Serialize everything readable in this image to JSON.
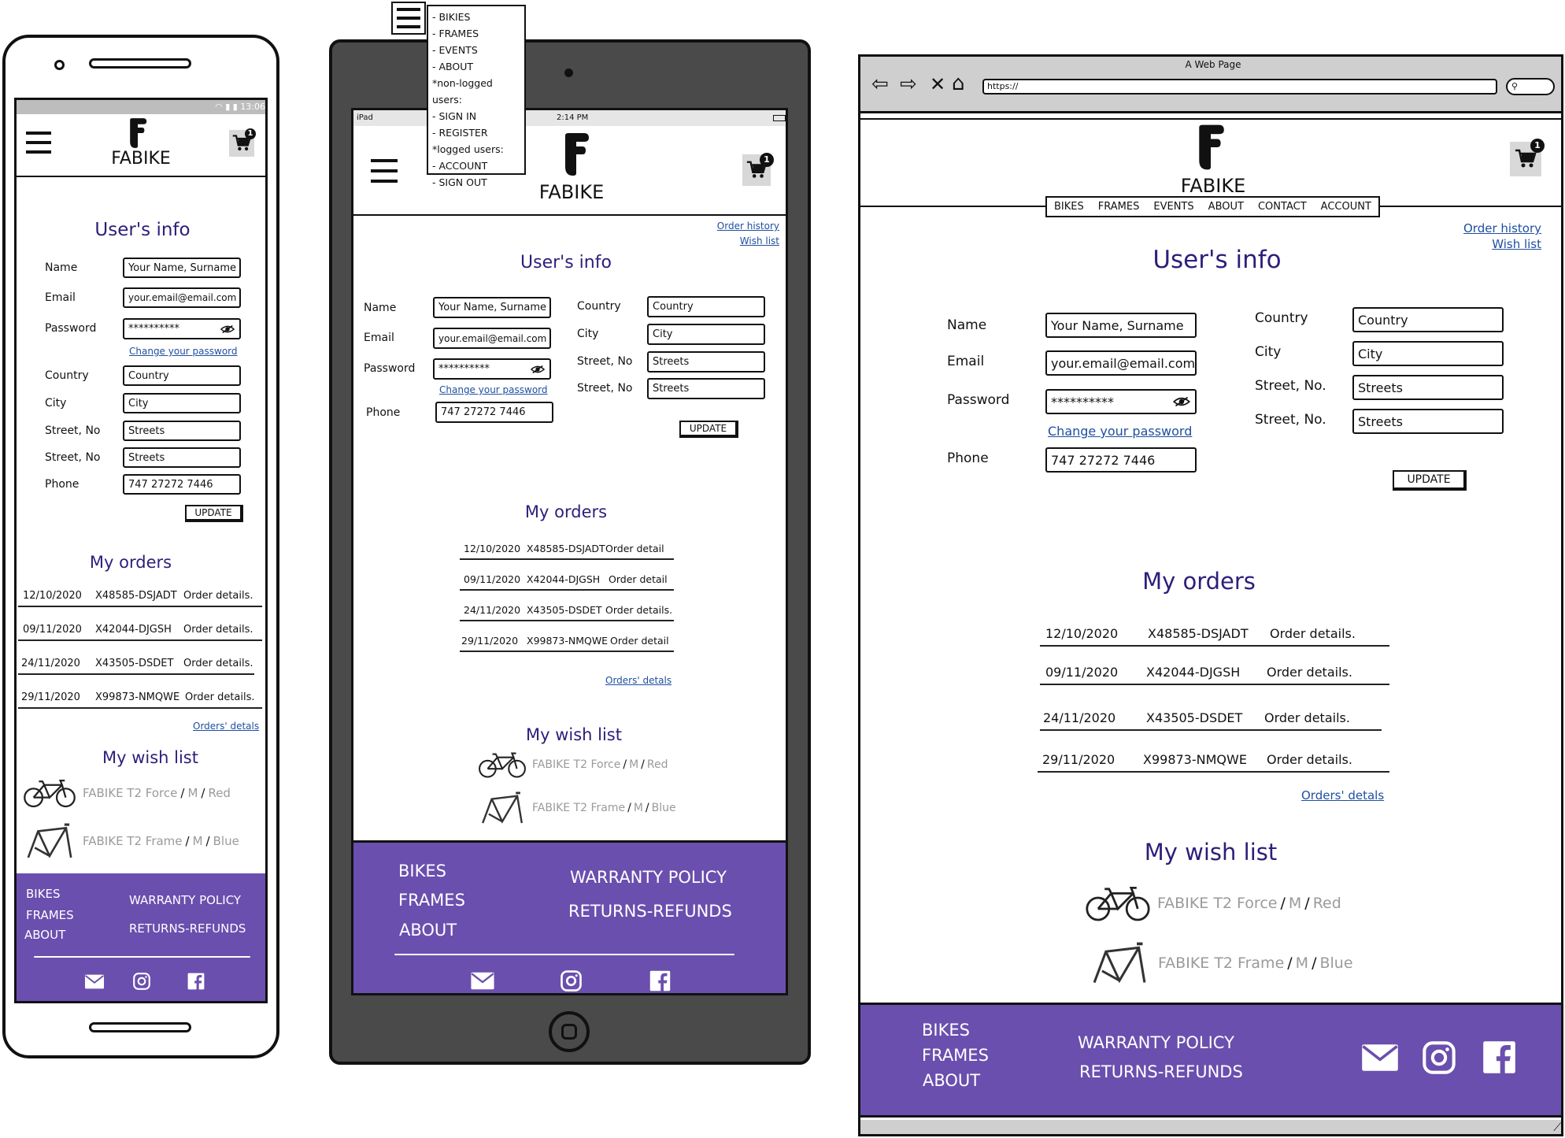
{
  "brand": "FABIKE",
  "colors": {
    "accent": "#6a4fae",
    "title": "#2d1e7a",
    "link": "#1f4fa0"
  },
  "cart_count": "1",
  "phone_status": {
    "time": "13:06"
  },
  "tablet_status": {
    "device": "iPad",
    "time": "2:14 PM"
  },
  "browser": {
    "title": "A Web Page",
    "url": "https://"
  },
  "hamburger_menu": {
    "items": [
      "- BIKIES",
      "- FRAMES",
      "- EVENTS",
      "- ABOUT",
      "*non-logged users:",
      "- SIGN IN",
      "- REGISTER",
      "*logged users:",
      "- ACCOUNT",
      "- SIGN OUT"
    ]
  },
  "nav": {
    "items": [
      "BIKES",
      "FRAMES",
      "EVENTS",
      "ABOUT",
      "CONTACT",
      "ACCOUNT"
    ]
  },
  "links": {
    "order_history": "Order history",
    "wish_list": "Wish list",
    "change_password": "Change your password",
    "orders_details": "Orders' detals"
  },
  "sections": {
    "users_info": "User's info",
    "my_orders": "My orders",
    "my_wish_list": "My wish list"
  },
  "form": {
    "name_label": "Name",
    "name_value": "Your Name, Surname",
    "email_label": "Email",
    "email_value": "your.email@email.com",
    "password_label": "Password",
    "password_value": "**********",
    "country_label": "Country",
    "country_value": "Country",
    "city_label": "City",
    "city_value": "City",
    "street_label_short": "Street, No",
    "street_label_dot": "Street, No.",
    "street_value": "Streets",
    "phone_label": "Phone",
    "phone_value": "747 27272 7446",
    "update_label": "UPDATE"
  },
  "orders": [
    {
      "date": "12/10/2020",
      "id": "X48585-DSJADT",
      "details": "Order details.",
      "details_short": "Order detail"
    },
    {
      "date": "09/11/2020",
      "id": "X42044-DJGSH",
      "details": "Order details.",
      "details_short": "Order detail"
    },
    {
      "date": "24/11/2020",
      "id": "X43505-DSDET",
      "details": "Order details.",
      "details_short": "Order details."
    },
    {
      "date": "29/11/2020",
      "id": "X99873-NMQWE",
      "details": "Order details.",
      "details_short": "Order detail"
    }
  ],
  "wishlist": [
    {
      "name": "FABIKE T2 Force",
      "size": "M",
      "color": "Red",
      "sep": "/",
      "icon": "road-bike-icon"
    },
    {
      "name": "FABIKE T2 Frame",
      "size": "M",
      "color": "Blue",
      "sep": "/",
      "icon": "bike-frame-icon"
    }
  ],
  "footer": {
    "links_left": [
      "BIKES",
      "FRAMES",
      "ABOUT"
    ],
    "links_right": [
      "WARRANTY POLICY",
      "RETURNS-REFUNDS"
    ],
    "social_icons": [
      "mail-icon",
      "instagram-icon",
      "facebook-icon"
    ]
  }
}
